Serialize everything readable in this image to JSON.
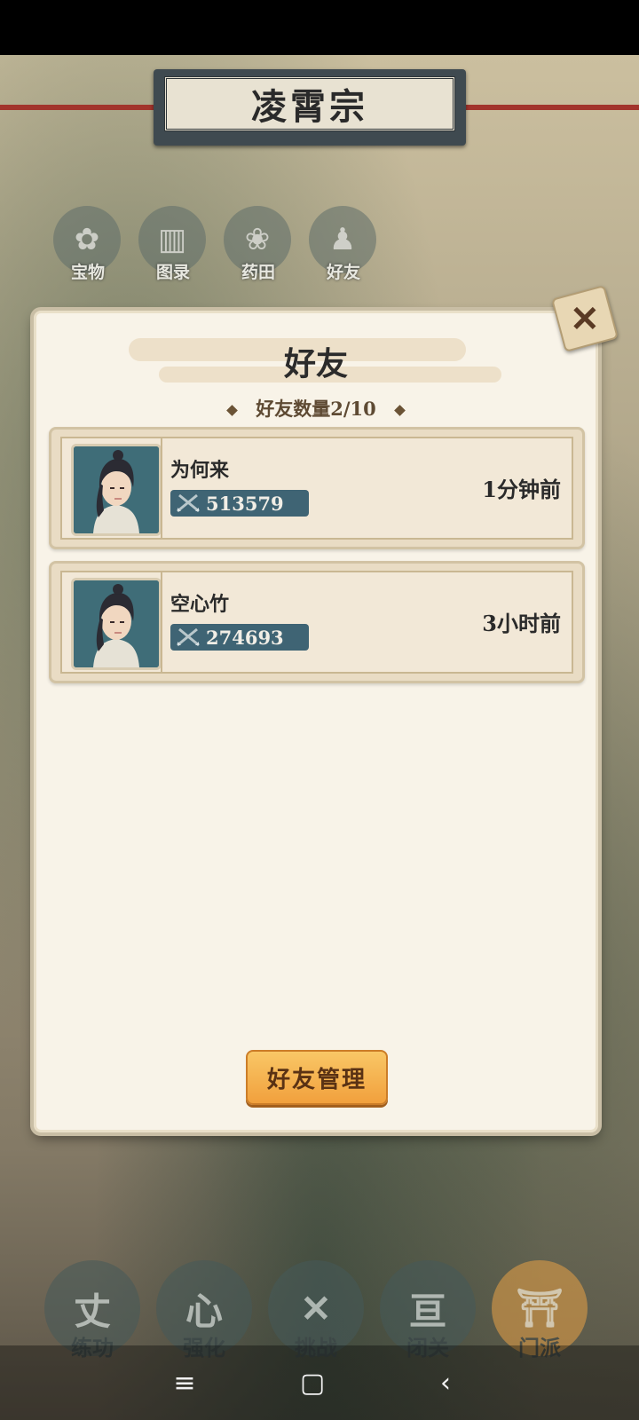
{
  "sect": {
    "title": "凌霄宗"
  },
  "quick_nav": [
    {
      "label": "宝物",
      "icon": "treasure-bag-icon",
      "glyph": "✿"
    },
    {
      "label": "图录",
      "icon": "scroll-book-icon",
      "glyph": "▥"
    },
    {
      "label": "药田",
      "icon": "herb-field-icon",
      "glyph": "❀"
    },
    {
      "label": "好友",
      "icon": "friends-icon",
      "glyph": "♟"
    }
  ],
  "dialog": {
    "title": "好友",
    "count_text": "好友数量2/10",
    "close_icon": "close-x-icon",
    "manage_label": "好友管理"
  },
  "friends": [
    {
      "name": "为何来",
      "power": "513579",
      "last_online": "1分钟前"
    },
    {
      "name": "空心竹",
      "power": "274693",
      "last_online": "3小时前"
    }
  ],
  "bottom_nav": [
    {
      "label": "练功",
      "glyph": "丈",
      "active": false
    },
    {
      "label": "强化",
      "glyph": "心",
      "active": false
    },
    {
      "label": "挑战",
      "glyph": "✕",
      "active": false
    },
    {
      "label": "闭关",
      "glyph": "亘",
      "active": false
    },
    {
      "label": "门派",
      "glyph": "⛩",
      "active": true
    }
  ],
  "system_nav": {
    "menu_glyph": "≡",
    "home_glyph": "▢",
    "back_glyph": "‹"
  },
  "colors": {
    "dialog_bg": "#f8f3e8",
    "card_bg": "#f2e8d7",
    "power_box": "#3f6474",
    "button": "#f1a03d"
  }
}
